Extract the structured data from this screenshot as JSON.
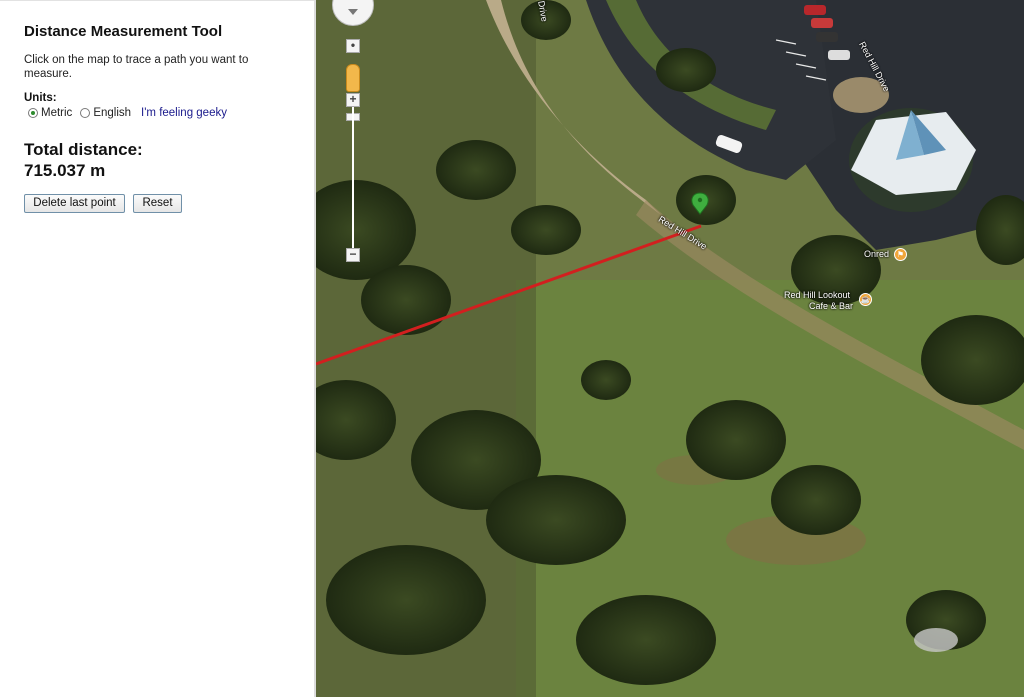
{
  "sidebar": {
    "title": "Distance Measurement Tool",
    "instructions": "Click on the map to trace a path you want to measure.",
    "units_label": "Units:",
    "units_options": [
      "Metric",
      "English"
    ],
    "units_selected": "Metric",
    "geeky_link": "I'm feeling geeky",
    "total_label": "Total distance:",
    "total_value": "715.037 m",
    "delete_button": "Delete last point",
    "reset_button": "Reset"
  },
  "map": {
    "road_label_1": "Red Hill Drive",
    "road_label_2": "Red Hill Drive",
    "road_label_3": "Drive",
    "poi_1": "Onred",
    "poi_2_line1": "Red Hill Lookout",
    "poi_2_line2": "Cafe & Bar",
    "zoom_in": "+",
    "zoom_out": "−",
    "path_color": "#d21f1f",
    "marker_color": "#3fae3f"
  }
}
